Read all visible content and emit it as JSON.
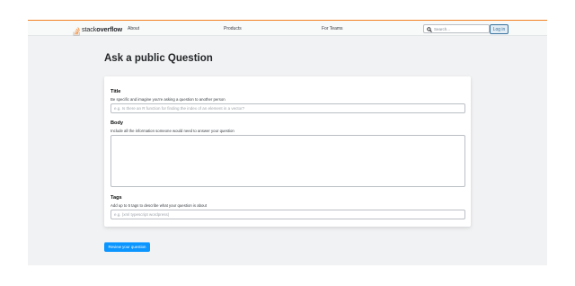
{
  "header": {
    "logo_text_light": "stack",
    "logo_text_bold": "overflow",
    "nav": {
      "about": "About",
      "products": "Products",
      "for_teams": "For Teams"
    },
    "search": {
      "placeholder": "Search..."
    },
    "login_label": "Log in",
    "accent_color": "#f48225"
  },
  "main": {
    "title": "Ask a public Question",
    "form": {
      "title": {
        "label": "Title",
        "description": "Be specific and imagine you're asking a question to another person",
        "placeholder": "e.g. Is there an R function for finding the index of an element in a vector?"
      },
      "body": {
        "label": "Body",
        "description": "Include all the information someone would need to answer your question"
      },
      "tags": {
        "label": "Tags",
        "description": "Add up to 5 tags to describe what your question is about",
        "placeholder": "e.g. (xml typescript wordpress)"
      }
    },
    "review_button": "Review your question",
    "button_color": "#0a95ff"
  }
}
